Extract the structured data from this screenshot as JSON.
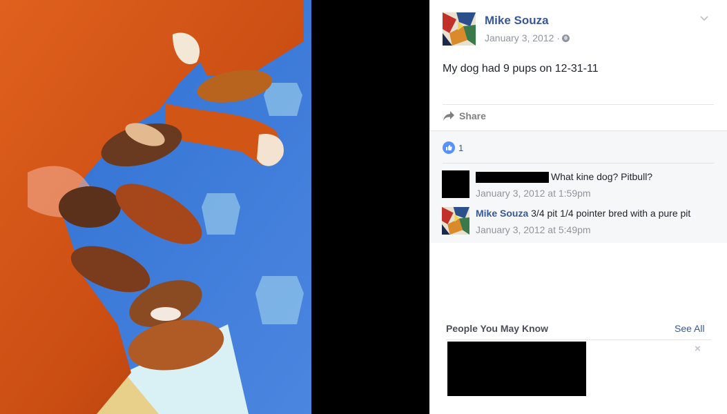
{
  "post": {
    "author": "Mike Souza",
    "date": "January 3, 2012 ·",
    "text": "My dog had 9 pups on 12-31-11",
    "share_label": "Share",
    "like_count": "1",
    "author_avatar_icon": "painting-avatar-icon",
    "privacy_icon": "globe-icon"
  },
  "comments": [
    {
      "author": "",
      "author_redacted": true,
      "text": "What kine dog? Pitbull?",
      "time": "January 3, 2012 at 1:59pm"
    },
    {
      "author": "Mike Souza",
      "text": "3/4 pit 1/4 pointer bred with a pure pit",
      "time": "January 3, 2012 at 5:49pm"
    }
  ],
  "sidebar": {
    "pymk_title": "People You May Know",
    "see_all": "See All",
    "close": "×"
  },
  "colors": {
    "link_blue": "#365899",
    "like_blue": "#5890ff",
    "muted_gray": "#90949c",
    "comments_bg": "#f6f7f9"
  }
}
